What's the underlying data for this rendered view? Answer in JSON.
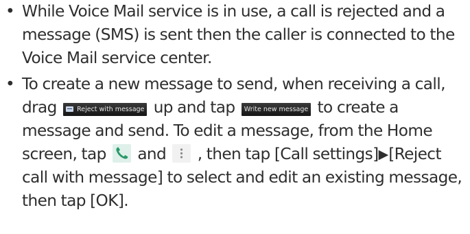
{
  "bullets": {
    "symbol": "•",
    "item1": {
      "text": "While Voice Mail service is in use, a call is rejected and a message (SMS) is sent then the caller is connected to the Voice Mail service center."
    },
    "item2": {
      "seg1": "To create a new message to send, when receiving a call, drag",
      "reject_button_label": "Reject with message",
      "seg2": "up and tap",
      "write_button_label": "Write new message",
      "seg3": "to create a message and send. To edit a message, from the Home screen, tap",
      "phone_icon": "phone-icon",
      "seg4": "and",
      "menu_icon": "menu-icon",
      "seg5": ", then tap [Call settings]",
      "arrow": "▶",
      "seg6": "[Reject call with message] to select and edit an existing message, then tap [OK]."
    }
  },
  "colors": {
    "text": "#2e2e2e",
    "phone_icon": "#2a9a6a",
    "button_bg": "#1e1e1e"
  }
}
